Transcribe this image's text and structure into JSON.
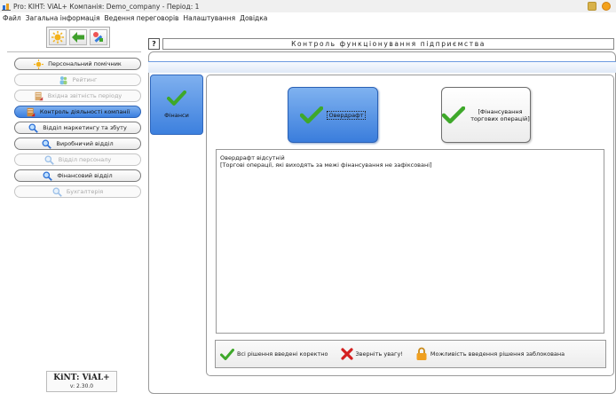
{
  "window": {
    "title": "Pro: KIHT: ViAL+   Компанія: Demo_company - Період: 1"
  },
  "menu": {
    "items": [
      {
        "label": "Файл"
      },
      {
        "label": "Загальна інформація"
      },
      {
        "label": "Ведення переговорів"
      },
      {
        "label": "Налаштування"
      },
      {
        "label": "Довідка"
      }
    ]
  },
  "sidebar": {
    "items": [
      {
        "label": "Персональний помічник",
        "icon": "sun-icon",
        "state": "normal"
      },
      {
        "label": "Рейтинг",
        "icon": "people-icon",
        "state": "disabled"
      },
      {
        "label": "Вхідна звітність періоду",
        "icon": "report-icon",
        "state": "disabled"
      },
      {
        "label": "Контроль діяльності компанії",
        "icon": "report-icon",
        "state": "active"
      },
      {
        "label": "Відділ маркетингу та збуту",
        "icon": "magnifier-icon",
        "state": "normal"
      },
      {
        "label": "Виробничий відділ",
        "icon": "magnifier-icon",
        "state": "normal"
      },
      {
        "label": "Відділ персоналу",
        "icon": "magnifier-icon",
        "state": "disabled"
      },
      {
        "label": "Фінансовий відділ",
        "icon": "magnifier-icon",
        "state": "normal"
      },
      {
        "label": "Бухгалтерія",
        "icon": "magnifier-icon",
        "state": "disabled"
      }
    ]
  },
  "brand": {
    "name": "KiNT: ViAL+",
    "version": "v: 2.30.0"
  },
  "header": {
    "help_label": "?",
    "title": "Контроль функціонування підприємства"
  },
  "side_tab": {
    "label": "Фінанси"
  },
  "buttons": {
    "overdraft": "Овердрафт",
    "trade_financing": "[Фінансування\nторгових операцій]"
  },
  "messages": [
    "Овердрафт відсутній",
    "[Торгові операції, які виходять за межі фінансування не зафіксовані]"
  ],
  "legend": {
    "ok": "Всі рішення введені коректно",
    "attention": "Зверніть увагу!",
    "locked": "Можливість введення рішення заблокована"
  },
  "colors": {
    "accent_blue": "#3a7ddc",
    "check_green": "#3ea82a",
    "cross_red": "#d42020",
    "lock_orange": "#f0a020"
  }
}
